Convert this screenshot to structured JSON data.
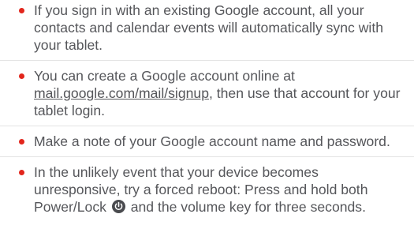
{
  "tips": {
    "item1": "If you sign in with an existing Google account, all your contacts and calendar events will automatically sync with your tablet.",
    "item2_before": "You can create a Google account online at ",
    "item2_link": "mail.google.com/mail/signup",
    "item2_after": ", then use that account for your tablet login.",
    "item3": "Make a note of your Google account name and password.",
    "item4_before": "In the unlikely event that your device becomes unresponsive, try a forced reboot: Press and hold both Power/Lock ",
    "item4_icon": "power-lock-icon",
    "item4_after": " and the volume key for three seconds."
  },
  "colors": {
    "bullet": "#e2261c",
    "text": "#55565a"
  }
}
